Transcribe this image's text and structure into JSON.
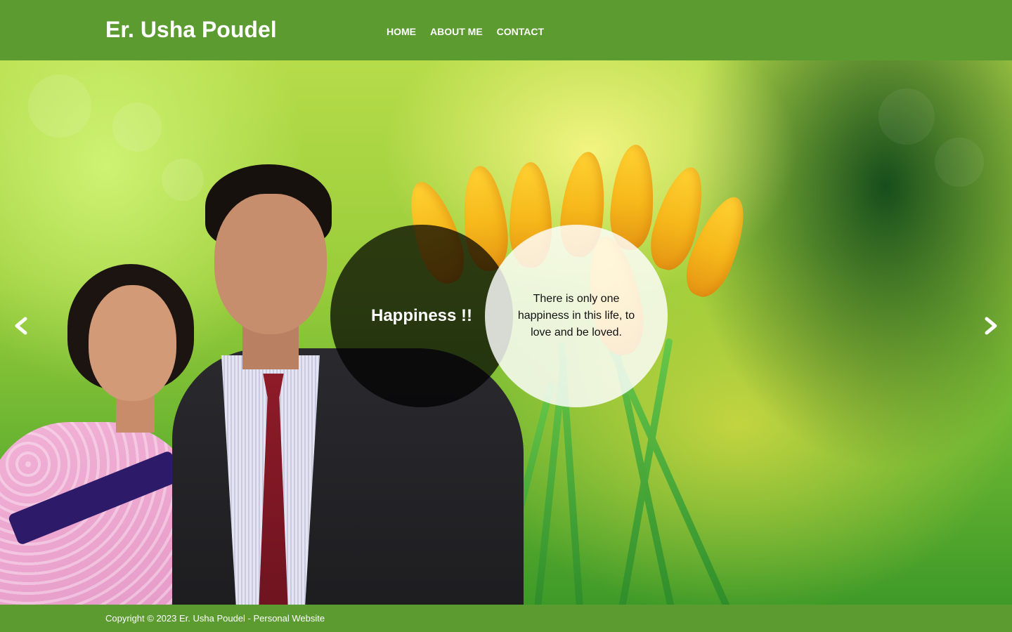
{
  "header": {
    "site_title": "Er. Usha Poudel",
    "nav": [
      {
        "label": "HOME"
      },
      {
        "label": "ABOUT ME"
      },
      {
        "label": "CONTACT"
      }
    ]
  },
  "hero": {
    "circle_title": "Happiness !!",
    "circle_quote": "There is only one happiness in this life, to love and be loved.",
    "prev_icon": "chevron-left-icon",
    "next_icon": "chevron-right-icon"
  },
  "footer": {
    "copyright": "Copyright © 2023 Er. Usha Poudel - Personal Website"
  },
  "colors": {
    "brand_green": "#5b9b30",
    "text_light": "#ffffff",
    "text_dark": "#111111"
  }
}
